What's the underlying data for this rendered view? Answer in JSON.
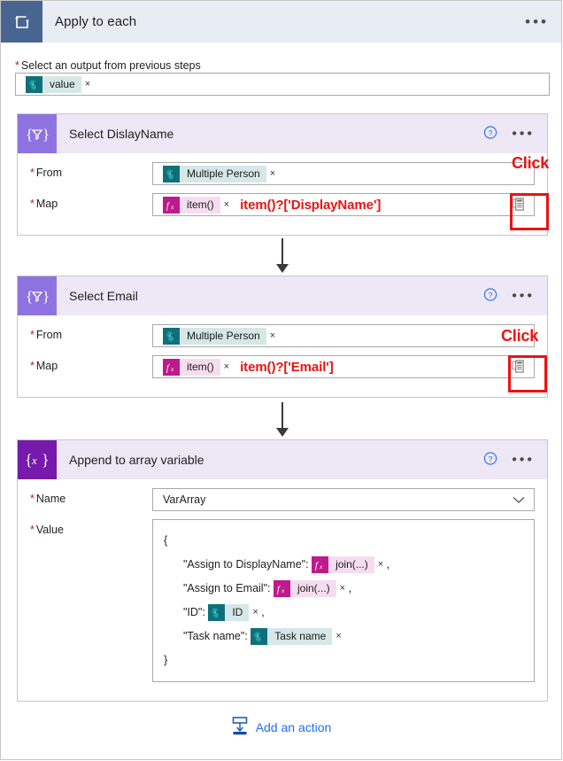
{
  "loop": {
    "title": "Apply to each",
    "icon": "loop-icon",
    "menu_icon": "ellipsis-icon",
    "select_output": {
      "label": "Select an output from previous steps",
      "required": true,
      "token": {
        "text": "value",
        "icon": "sharepoint-icon",
        "remove": "×"
      }
    }
  },
  "cards": [
    {
      "id": "select-displayname",
      "title": "Select DislayName",
      "icon": "select-braces-funnel-icon",
      "help_icon": "question-circle-icon",
      "menu_icon": "ellipsis-icon",
      "fields": {
        "from": {
          "label": "From",
          "required": true,
          "token": {
            "text": "Multiple Person",
            "icon": "sharepoint-icon",
            "remove": "×"
          }
        },
        "map": {
          "label": "Map",
          "required": true,
          "token": {
            "text": "item()",
            "icon": "fx-icon",
            "remove": "×"
          },
          "annotation": "item()?['DisplayName']",
          "copy_icon": "clipboard-copy-icon"
        }
      },
      "callout": {
        "text": "Click",
        "color": "#ee1111"
      }
    },
    {
      "id": "select-email",
      "title": "Select Email",
      "icon": "select-braces-funnel-icon",
      "help_icon": "question-circle-icon",
      "menu_icon": "ellipsis-icon",
      "fields": {
        "from": {
          "label": "From",
          "required": true,
          "token": {
            "text": "Multiple Person",
            "icon": "sharepoint-icon",
            "remove": "×"
          }
        },
        "map": {
          "label": "Map",
          "required": true,
          "token": {
            "text": "item()",
            "icon": "fx-icon",
            "remove": "×"
          },
          "annotation": "item()?['Email']",
          "copy_icon": "clipboard-copy-icon"
        }
      },
      "callout": {
        "text": "Click",
        "color": "#ee1111"
      }
    }
  ],
  "append_card": {
    "id": "append-to-array-variable",
    "title": "Append to array variable",
    "icon": "braces-x-icon",
    "help_icon": "question-circle-icon",
    "menu_icon": "ellipsis-icon",
    "name_field": {
      "label": "Name",
      "required": true,
      "value": "VarArray",
      "chevron_icon": "chevron-down-icon"
    },
    "value_field": {
      "label": "Value",
      "required": true,
      "open_brace": "{",
      "close_brace": "}",
      "entries": [
        {
          "key": "\"Assign to DisplayName\":",
          "token": {
            "text": "join(...)",
            "icon": "fx-icon",
            "remove": "×"
          },
          "trailing": ","
        },
        {
          "key": "\"Assign to Email\":",
          "token": {
            "text": "join(...)",
            "icon": "fx-icon",
            "remove": "×"
          },
          "trailing": ","
        },
        {
          "key": "\"ID\":",
          "token": {
            "text": "ID",
            "icon": "sharepoint-icon",
            "remove": "×"
          },
          "trailing": ","
        },
        {
          "key": "\"Task name\":",
          "token": {
            "text": "Task name",
            "icon": "sharepoint-icon",
            "remove": "×"
          },
          "trailing": ""
        }
      ]
    }
  },
  "add_action": {
    "label": "Add an action",
    "icon": "insert-below-icon",
    "color": "#1f6feb"
  },
  "colors": {
    "loop_header_bg": "#e8edf4",
    "loop_icon_bg": "#486591",
    "card_header_bg": "#ede7f6",
    "select_icon_bg": "#8e72e0",
    "append_icon_bg": "#7719aa",
    "sharepoint_teal": "#10707a",
    "sharepoint_chip": "#d6e7e7",
    "fx_magenta": "#bf1a8d",
    "fx_chip": "#f5ddef",
    "annotation_red": "#ee1111",
    "link_blue": "#1f6feb"
  }
}
